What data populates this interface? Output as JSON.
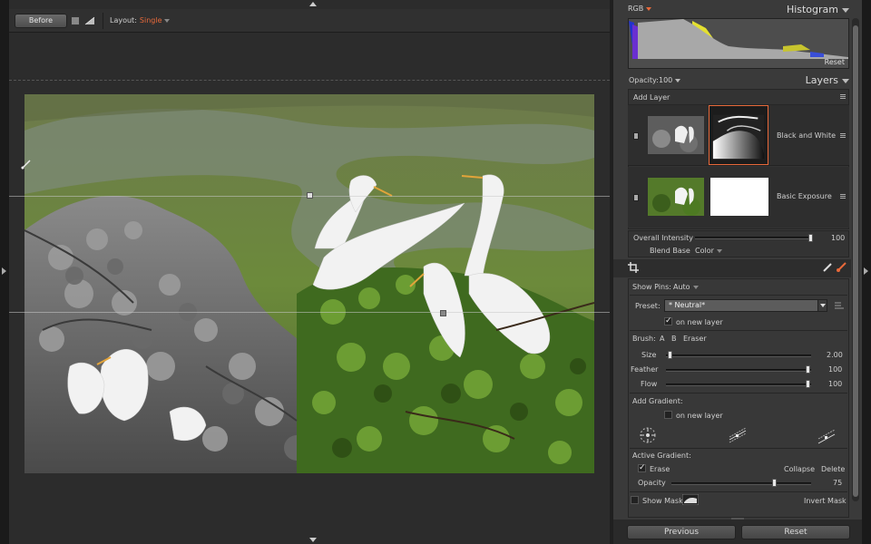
{
  "toolbar": {
    "before_label": "Before",
    "layout_label": "Layout:",
    "layout_value": "Single"
  },
  "histogram": {
    "channel": "RGB",
    "title": "Histogram",
    "reset_label": "Reset"
  },
  "layers": {
    "opacity_label": "Opacity:",
    "opacity_value": "100",
    "title": "Layers",
    "add_layer_label": "Add Layer",
    "items": [
      {
        "name": "Black and White",
        "selected": true
      },
      {
        "name": "Basic Exposure",
        "selected": false
      }
    ],
    "overall_intensity_label": "Overall Intensity",
    "overall_intensity_value": "100",
    "blend_base_label": "Blend Base",
    "blend_base_value": "Color"
  },
  "mask_panel": {
    "show_pins_label": "Show Pins:",
    "show_pins_value": "Auto",
    "preset_label": "Preset:",
    "preset_value": "* Neutral*",
    "on_new_layer_label": "on new layer",
    "brush_label": "Brush:",
    "brush_a": "A",
    "brush_b": "B",
    "brush_eraser": "Eraser",
    "size_label": "Size",
    "size_value": "2.00",
    "feather_label": "Feather",
    "feather_value": "100",
    "flow_label": "Flow",
    "flow_value": "100",
    "add_gradient_label": "Add Gradient:",
    "gradient_on_new_layer_label": "on new layer",
    "active_gradient_label": "Active Gradient:",
    "erase_label": "Erase",
    "collapse_label": "Collapse",
    "delete_label": "Delete",
    "opacity_label": "Opacity",
    "opacity_value": "75",
    "show_mask_label": "Show Mask",
    "invert_mask_label": "Invert Mask"
  },
  "footer": {
    "previous_label": "Previous",
    "reset_label": "Reset"
  },
  "colors": {
    "accent": "#e8693a",
    "panel_bg": "#3a3a3a",
    "canvas_bg": "#2c2c2c"
  }
}
